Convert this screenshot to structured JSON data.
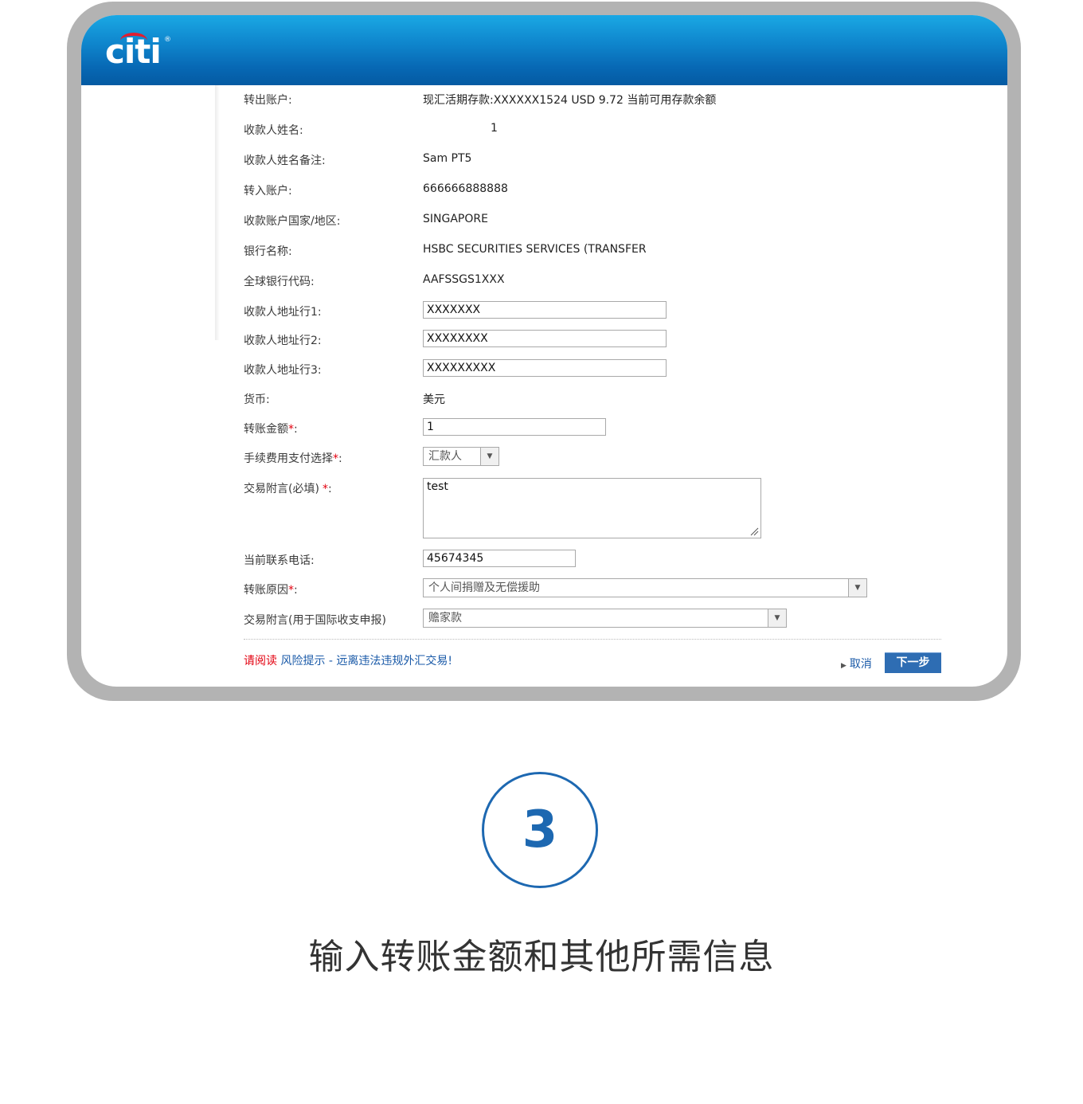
{
  "header": {
    "logo_text": "citi",
    "logo_mark": "®"
  },
  "form": {
    "from_account": {
      "label": "转出账户:",
      "value": "现汇活期存款:XXXXXX1524 USD 9.72 当前可用存款余额"
    },
    "payee_name": {
      "label": "收款人姓名:",
      "value": "1"
    },
    "payee_name_remark": {
      "label": "收款人姓名备注:",
      "value": "Sam PT5"
    },
    "to_account": {
      "label": "转入账户:",
      "value": "666666888888"
    },
    "payee_country": {
      "label": "收款账户国家/地区:",
      "value": "SINGAPORE"
    },
    "bank_name": {
      "label": "银行名称:",
      "value": "HSBC SECURITIES SERVICES (TRANSFER"
    },
    "swift_code": {
      "label": "全球银行代码:",
      "value": "AAFSSGS1XXX"
    },
    "address1": {
      "label": "收款人地址行1:",
      "value": "XXXXXXX"
    },
    "address2": {
      "label": "收款人地址行2:",
      "value": "XXXXXXXX"
    },
    "address3": {
      "label": "收款人地址行3:",
      "value": "XXXXXXXXX"
    },
    "currency": {
      "label": "货币:",
      "value": "美元"
    },
    "amount": {
      "label": "转账金额",
      "required_mark": "*",
      "colon": ":",
      "value": "1"
    },
    "fee_option": {
      "label": "手续费用支付选择",
      "required_mark": "*",
      "colon": ":",
      "value": "汇款人"
    },
    "memo": {
      "label": "交易附言(必填)",
      "required_mark": "*",
      "colon": ":",
      "value": "test"
    },
    "phone": {
      "label": "当前联系电话:",
      "value": "45674345"
    },
    "reason": {
      "label": "转账原因",
      "required_mark": "*",
      "colon": ":",
      "value": "个人间捐赠及无偿援助"
    },
    "intl_memo": {
      "label": "交易附言(用于国际收支申报)",
      "value": "赡家款"
    }
  },
  "footer": {
    "notice_prefix": "请阅读",
    "notice_link": "风险提示 - 远离违法违规外汇交易!",
    "cancel_label": "取消",
    "next_label": "下一步"
  },
  "step": {
    "number": "3",
    "caption": "输入转账金额和其他所需信息"
  },
  "colors": {
    "brand_blue": "#0768b4",
    "accent_red": "#e3000f",
    "step_blue": "#1d68b1"
  }
}
